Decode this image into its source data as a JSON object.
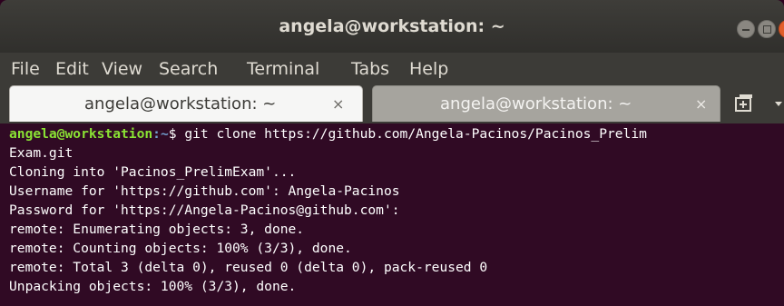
{
  "window": {
    "title": "angela@workstation: ~"
  },
  "menu": {
    "items": [
      "File",
      "Edit",
      "View",
      "Search",
      "Terminal",
      "Tabs",
      "Help"
    ]
  },
  "tabs": [
    {
      "label": "angela@workstation: ~",
      "close": "×",
      "active": true
    },
    {
      "label": "angela@workstation: ~",
      "close": "×",
      "active": false
    }
  ],
  "icons": {
    "new_tab": "new-tab-icon",
    "tab_menu": "chevron-down-icon"
  },
  "terminal": {
    "prompt_user": "angela@workstation",
    "prompt_path": ":~",
    "prompt_symbol": "$ ",
    "command": "git clone https://github.com/Angela-Pacinos/Pacinos_Prelim",
    "output": [
      "Exam.git",
      "Cloning into 'Pacinos_PrelimExam'...",
      "Username for 'https://github.com': Angela-Pacinos",
      "Password for 'https://Angela-Pacinos@github.com':",
      "remote: Enumerating objects: 3, done.",
      "remote: Counting objects: 100% (3/3), done.",
      "remote: Total 3 (delta 0), reused 0 (delta 0), pack-reused 0",
      "Unpacking objects: 100% (3/3), done."
    ]
  },
  "colors": {
    "terminal_bg": "#300a24",
    "prompt_user": "#8ae234",
    "prompt_path": "#729fcf",
    "close_button": "#e25e2a"
  }
}
